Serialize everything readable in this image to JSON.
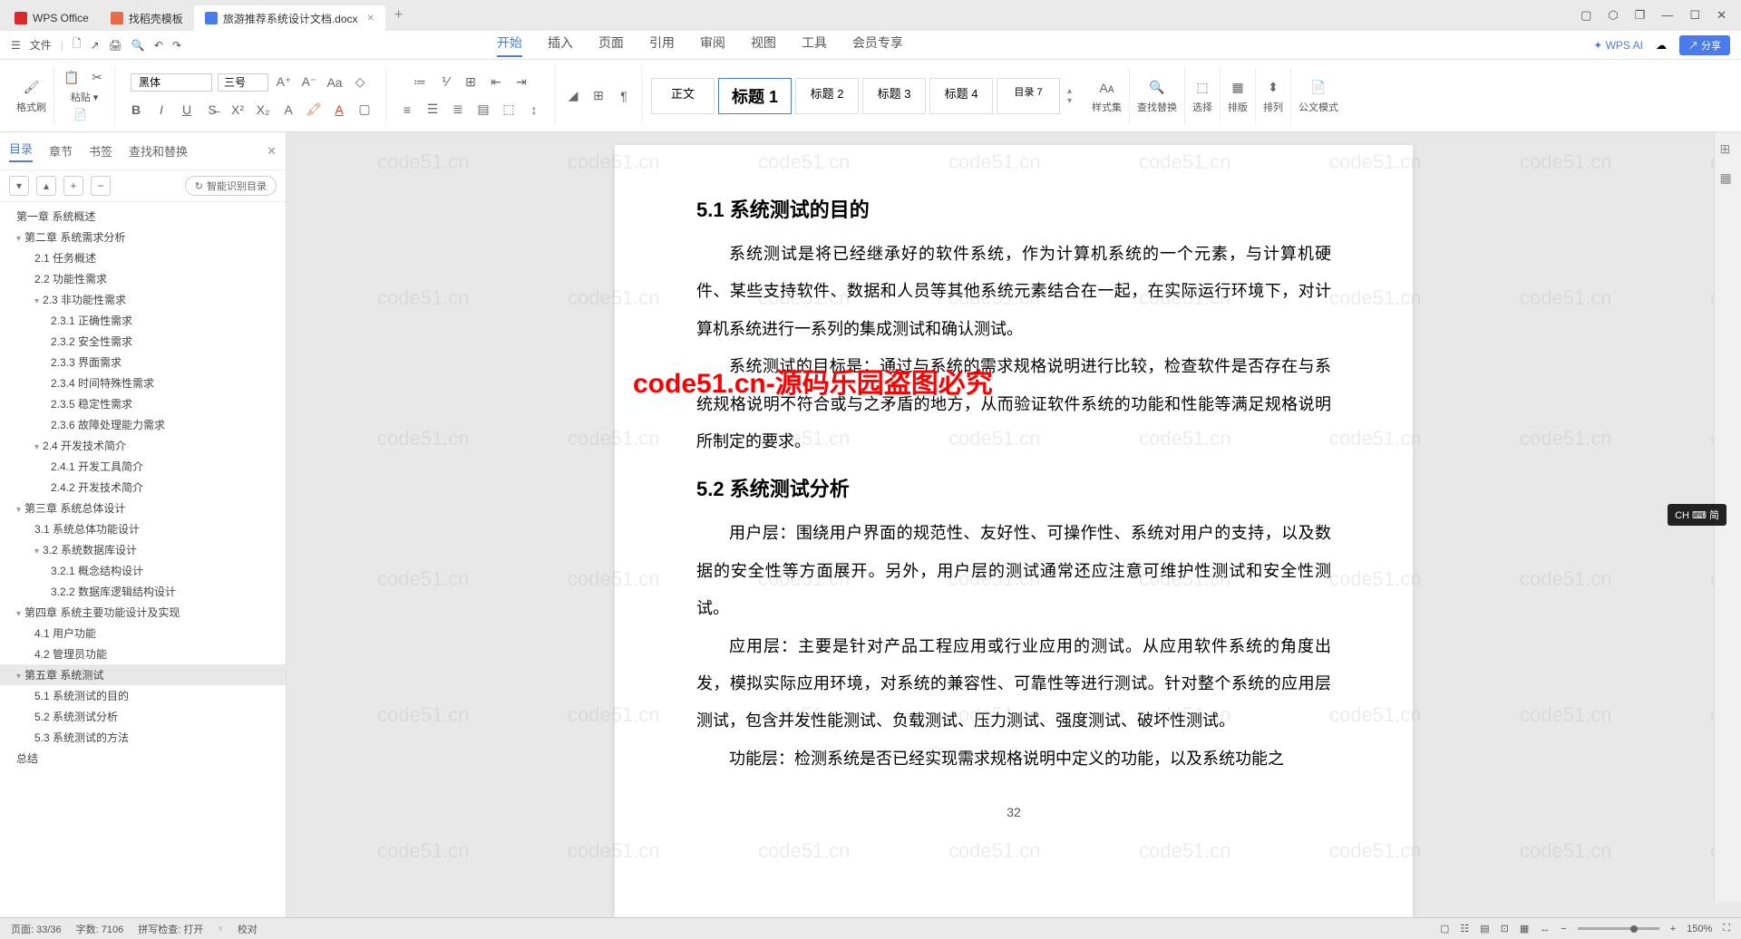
{
  "tabs": {
    "t1": "WPS Office",
    "t2": "找稻壳模板",
    "t3": "旅游推荐系统设计文档.docx"
  },
  "menu": {
    "file": "文件",
    "tabs": [
      "开始",
      "插入",
      "页面",
      "引用",
      "审阅",
      "视图",
      "工具",
      "会员专享"
    ],
    "ai": "WPS AI",
    "share": "分享"
  },
  "ribbon": {
    "format": "格式刷",
    "paste": "粘贴",
    "font": "黑体",
    "size": "三号",
    "body": "正文",
    "h1": "标题 1",
    "h2": "标题 2",
    "h3": "标题 3",
    "h4": "标题 4",
    "toc": "目录 7",
    "stylegrp": "样式集",
    "findrep": "查找替换",
    "select": "选择",
    "layout": "排版",
    "arrange": "排列",
    "docmode": "公文模式"
  },
  "side": {
    "tabs": [
      "目录",
      "章节",
      "书签",
      "查找和替换"
    ],
    "smart": "智能识别目录",
    "items": [
      {
        "l": 1,
        "t": "第一章 系统概述",
        "c": 0
      },
      {
        "l": 1,
        "t": "第二章 系统需求分析",
        "c": 1
      },
      {
        "l": 2,
        "t": "2.1 任务概述",
        "c": 0
      },
      {
        "l": 2,
        "t": "2.2 功能性需求",
        "c": 0
      },
      {
        "l": 2,
        "t": "2.3 非功能性需求",
        "c": 1
      },
      {
        "l": 3,
        "t": "2.3.1 正确性需求",
        "c": 0
      },
      {
        "l": 3,
        "t": "2.3.2 安全性需求",
        "c": 0
      },
      {
        "l": 3,
        "t": "2.3.3 界面需求",
        "c": 0
      },
      {
        "l": 3,
        "t": "2.3.4 时间特殊性需求",
        "c": 0
      },
      {
        "l": 3,
        "t": "2.3.5 稳定性需求",
        "c": 0
      },
      {
        "l": 3,
        "t": "2.3.6 故障处理能力需求",
        "c": 0
      },
      {
        "l": 2,
        "t": "2.4 开发技术简介",
        "c": 1
      },
      {
        "l": 3,
        "t": "2.4.1 开发工具简介",
        "c": 0
      },
      {
        "l": 3,
        "t": "2.4.2 开发技术简介",
        "c": 0
      },
      {
        "l": 1,
        "t": "第三章 系统总体设计",
        "c": 1
      },
      {
        "l": 2,
        "t": "3.1 系统总体功能设计",
        "c": 0
      },
      {
        "l": 2,
        "t": "3.2 系统数据库设计",
        "c": 1
      },
      {
        "l": 3,
        "t": "3.2.1 概念结构设计",
        "c": 0
      },
      {
        "l": 3,
        "t": "3.2.2 数据库逻辑结构设计",
        "c": 0
      },
      {
        "l": 1,
        "t": "第四章 系统主要功能设计及实现",
        "c": 1
      },
      {
        "l": 2,
        "t": "4.1 用户功能",
        "c": 0
      },
      {
        "l": 2,
        "t": "4.2 管理员功能",
        "c": 0
      },
      {
        "l": 1,
        "t": "第五章 系统测试",
        "c": 1,
        "sel": 1
      },
      {
        "l": 2,
        "t": "5.1 系统测试的目的",
        "c": 0
      },
      {
        "l": 2,
        "t": "5.2 系统测试分析",
        "c": 0
      },
      {
        "l": 2,
        "t": "5.3 系统测试的方法",
        "c": 0
      },
      {
        "l": 1,
        "t": "总结",
        "c": 0
      }
    ]
  },
  "doc": {
    "h1": "5.1  系统测试的目的",
    "p1": "系统测试是将已经继承好的软件系统，作为计算机系统的一个元素，与计算机硬件、某些支持软件、数据和人员等其他系统元素结合在一起，在实际运行环境下，对计算机系统进行一系列的集成测试和确认测试。",
    "p2": "系统测试的目标是：通过与系统的需求规格说明进行比较，检查软件是否存在与系统规格说明不符合或与之矛盾的地方，从而验证软件系统的功能和性能等满足规格说明所制定的要求。",
    "h2": "5.2  系统测试分析",
    "p3": "用户层：围绕用户界面的规范性、友好性、可操作性、系统对用户的支持，以及数据的安全性等方面展开。另外，用户层的测试通常还应注意可维护性测试和安全性测试。",
    "p4": "应用层：主要是针对产品工程应用或行业应用的测试。从应用软件系统的角度出发，模拟实际应用环境，对系统的兼容性、可靠性等进行测试。针对整个系统的应用层测试，包含并发性能测试、负载测试、压力测试、强度测试、破坏性测试。",
    "p5": "功能层：检测系统是否已经实现需求规格说明中定义的功能，以及系统功能之",
    "pagenum": "32",
    "watermark": "code51.cn-源码乐园盗图必究",
    "wm_light": "code51.cn"
  },
  "status": {
    "page": "页面: 33/36",
    "words": "字数: 7106",
    "spell": "拼写检查: 打开",
    "proof": "校对",
    "zoom": "150%",
    "ime": "CH ⌨ 简"
  }
}
